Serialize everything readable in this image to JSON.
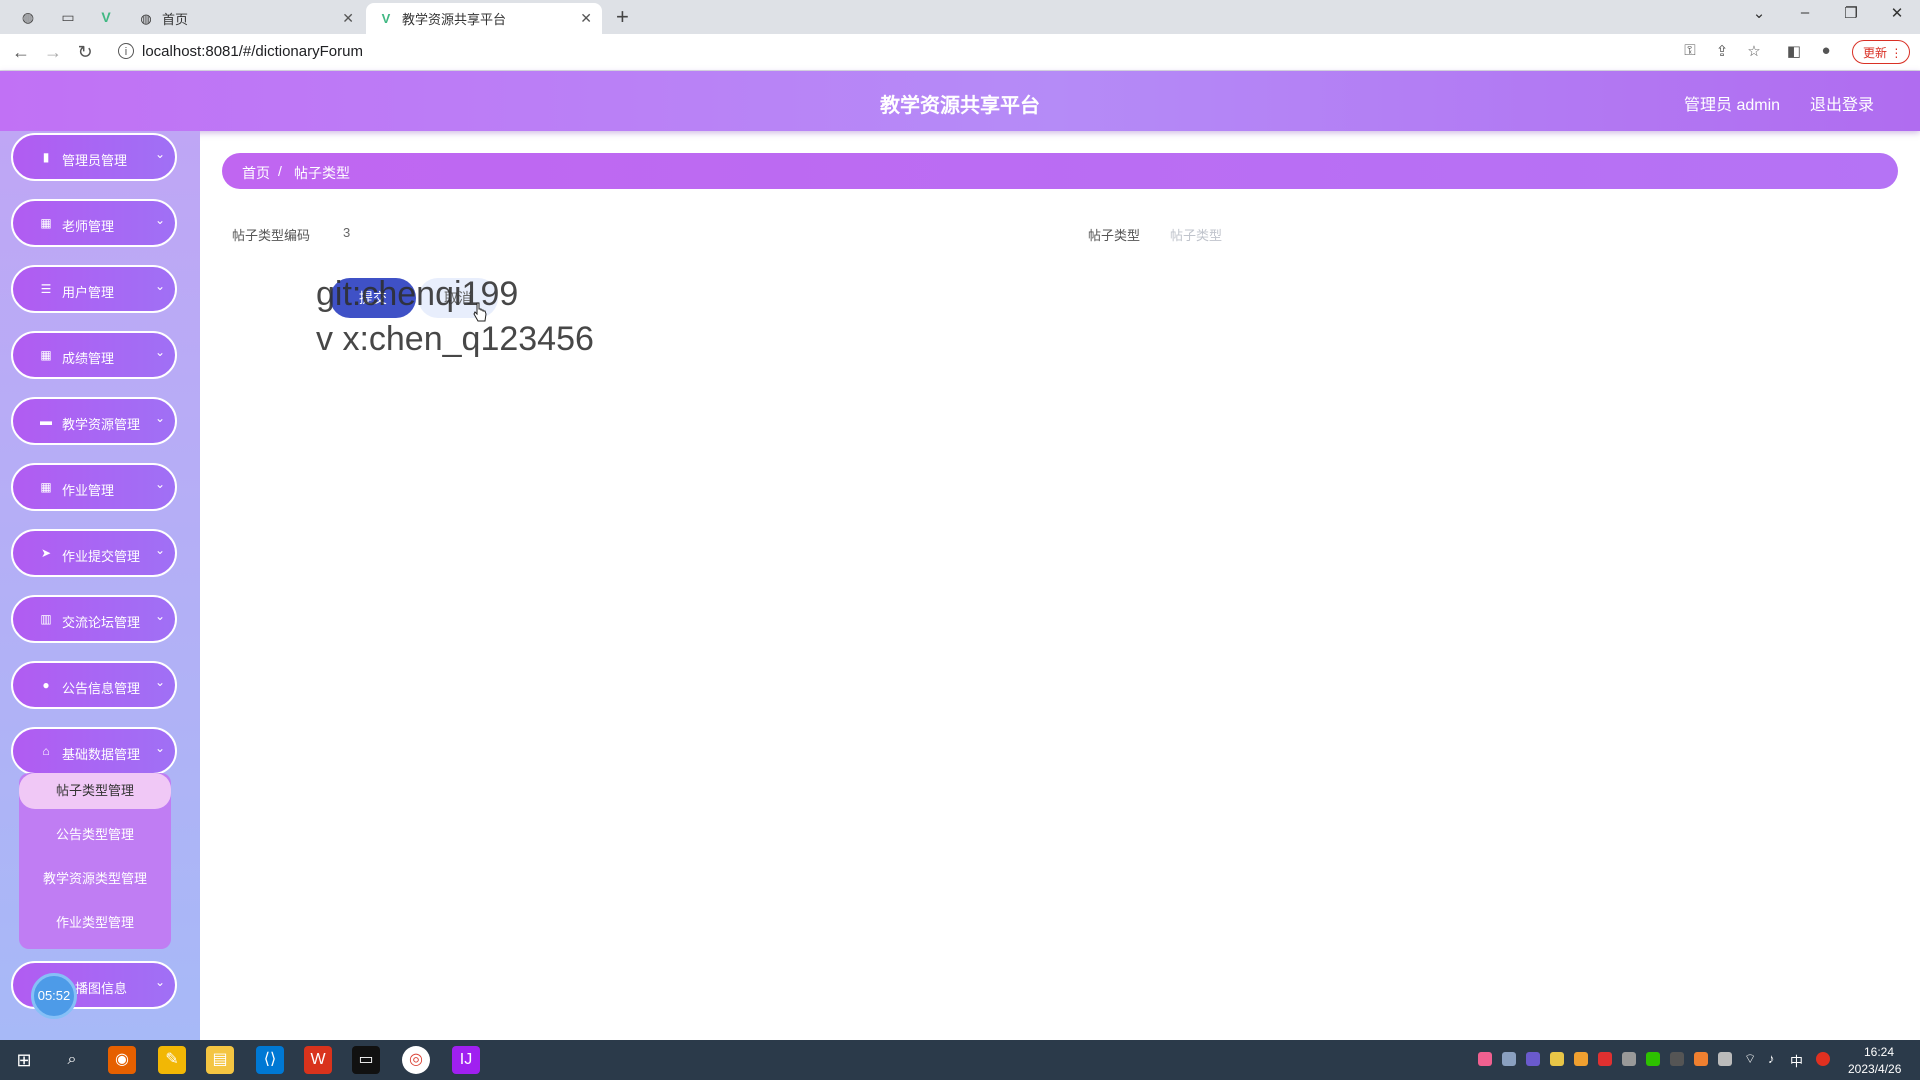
{
  "browser": {
    "tabs": [
      {
        "title": "首页",
        "active": false
      },
      {
        "title": "教学资源共享平台",
        "active": true
      }
    ],
    "url": "localhost:8081/#/dictionaryForum",
    "update_label": "更新"
  },
  "header": {
    "title": "教学资源共享平台",
    "user": "管理员 admin",
    "logout": "退出登录"
  },
  "sidebar": {
    "items": [
      {
        "label": "管理员管理",
        "icon": "clipboard-icon"
      },
      {
        "label": "老师管理",
        "icon": "grid-icon"
      },
      {
        "label": "用户管理",
        "icon": "list-icon"
      },
      {
        "label": "成绩管理",
        "icon": "grid-icon"
      },
      {
        "label": "教学资源管理",
        "icon": "ticket-icon"
      },
      {
        "label": "作业管理",
        "icon": "grid-icon"
      },
      {
        "label": "作业提交管理",
        "icon": "send-icon"
      },
      {
        "label": "交流论坛管理",
        "icon": "bar-chart-icon"
      },
      {
        "label": "公告信息管理",
        "icon": "location-icon"
      },
      {
        "label": "基础数据管理",
        "icon": "home-icon"
      },
      {
        "label": "轮播图信息",
        "icon": "image-icon"
      }
    ],
    "submenu": [
      {
        "label": "帖子类型管理",
        "active": true
      },
      {
        "label": "公告类型管理",
        "active": false
      },
      {
        "label": "教学资源类型管理",
        "active": false
      },
      {
        "label": "作业类型管理",
        "active": false
      }
    ],
    "timer": "05:52"
  },
  "breadcrumb": {
    "home": "首页",
    "separator": "/",
    "current": "帖子类型"
  },
  "form": {
    "code_label": "帖子类型编码",
    "code_value": "3",
    "type_label": "帖子类型",
    "type_placeholder": "帖子类型",
    "submit_label": "提交",
    "cancel_label": "取消"
  },
  "overlay": {
    "line1": "git:chenqi199",
    "line2": "v x:chen_q123456"
  },
  "taskbar": {
    "time": "16:24",
    "date": "2023/4/26",
    "ime": "中"
  }
}
